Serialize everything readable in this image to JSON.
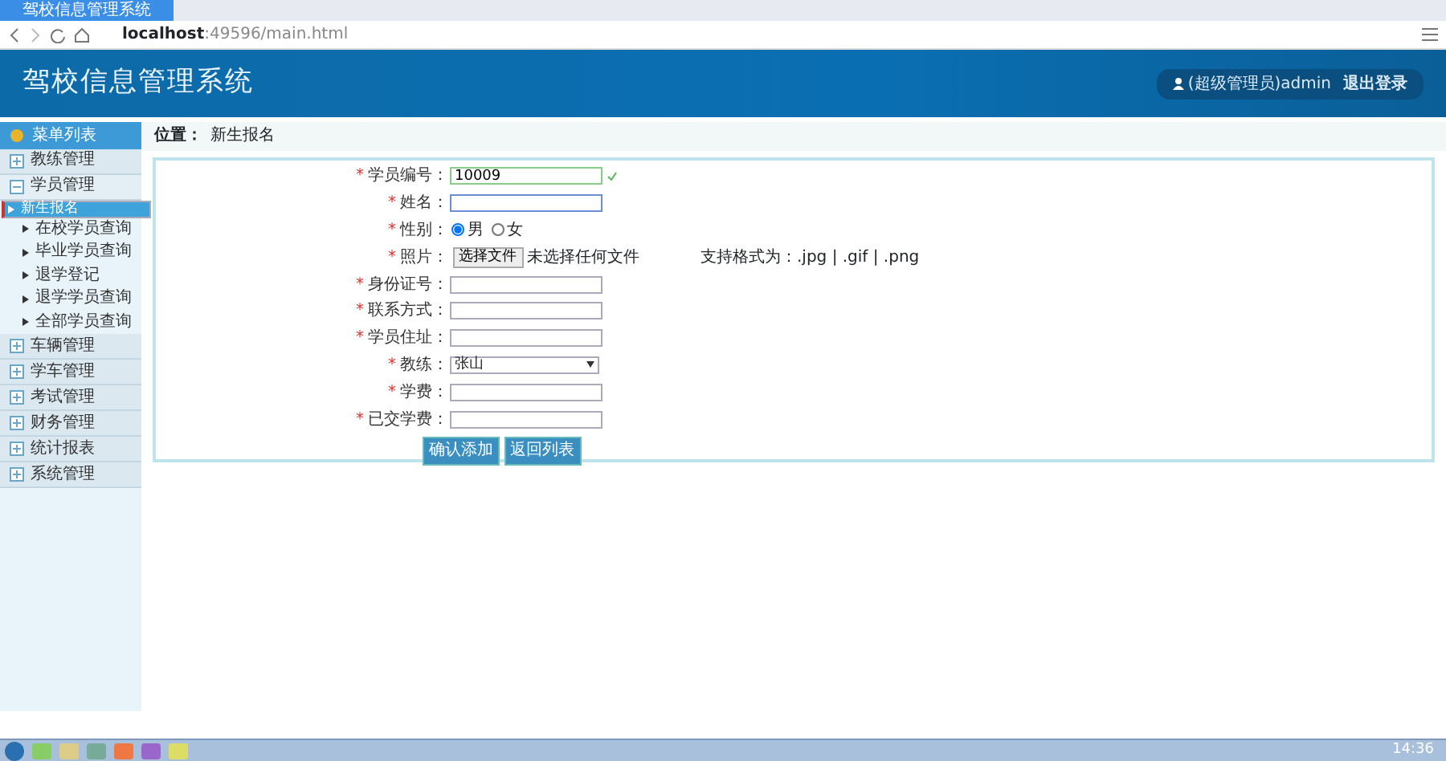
{
  "browser": {
    "tab_title": "驾校信息管理系统",
    "url_host": "localhost",
    "url_rest": ":49596/main.html"
  },
  "header": {
    "title": "驾校信息管理系统",
    "user": "(超级管理员)admin",
    "logout": "退出登录"
  },
  "sidebar": {
    "title": "菜单列表",
    "items": [
      {
        "label": "教练管理",
        "expanded": false
      },
      {
        "label": "学员管理",
        "expanded": true,
        "children": [
          {
            "label": "新生报名",
            "selected": true
          },
          {
            "label": "在校学员查询",
            "selected": false
          },
          {
            "label": "毕业学员查询",
            "selected": false
          },
          {
            "label": "退学登记",
            "selected": false
          },
          {
            "label": "退学学员查询",
            "selected": false
          },
          {
            "label": "全部学员查询",
            "selected": false
          }
        ]
      },
      {
        "label": "车辆管理",
        "expanded": false
      },
      {
        "label": "学车管理",
        "expanded": false
      },
      {
        "label": "考试管理",
        "expanded": false
      },
      {
        "label": "财务管理",
        "expanded": false
      },
      {
        "label": "统计报表",
        "expanded": false
      },
      {
        "label": "系统管理",
        "expanded": false
      }
    ]
  },
  "breadcrumb": {
    "label": "位置：",
    "page": "新生报名"
  },
  "form": {
    "required_marker": "*",
    "fields": [
      {
        "kind": "text",
        "label": "学员编号：",
        "required": true,
        "value": "10009",
        "valid": true,
        "focused": false
      },
      {
        "kind": "text",
        "label": "姓名：",
        "required": true,
        "valid": false,
        "focused": true
      },
      {
        "kind": "radio",
        "label": "性别：",
        "required": true,
        "options": [
          {
            "label": "男",
            "selected": true
          },
          {
            "label": "女",
            "selected": false
          }
        ]
      },
      {
        "kind": "file",
        "label": "照片：",
        "required": true,
        "button": "选择文件",
        "status": "未选择任何文件",
        "hint": "支持格式为：.jpg | .gif | .png"
      },
      {
        "kind": "text",
        "label": "身份证号：",
        "required": true,
        "valid": false,
        "focused": false
      },
      {
        "kind": "text",
        "label": "联系方式：",
        "required": true,
        "valid": false,
        "focused": false
      },
      {
        "kind": "text",
        "label": "学员住址：",
        "required": true,
        "valid": false,
        "focused": false
      },
      {
        "kind": "select",
        "label": "教练：",
        "required": true,
        "value": "张山"
      },
      {
        "kind": "text",
        "label": "学费：",
        "required": true,
        "valid": false,
        "focused": false
      },
      {
        "kind": "text",
        "label": "已交学费：",
        "required": true,
        "valid": false,
        "focused": false
      }
    ],
    "buttons": [
      "确认添加",
      "返回列表"
    ]
  },
  "taskbar": {
    "clock": "14:36"
  }
}
